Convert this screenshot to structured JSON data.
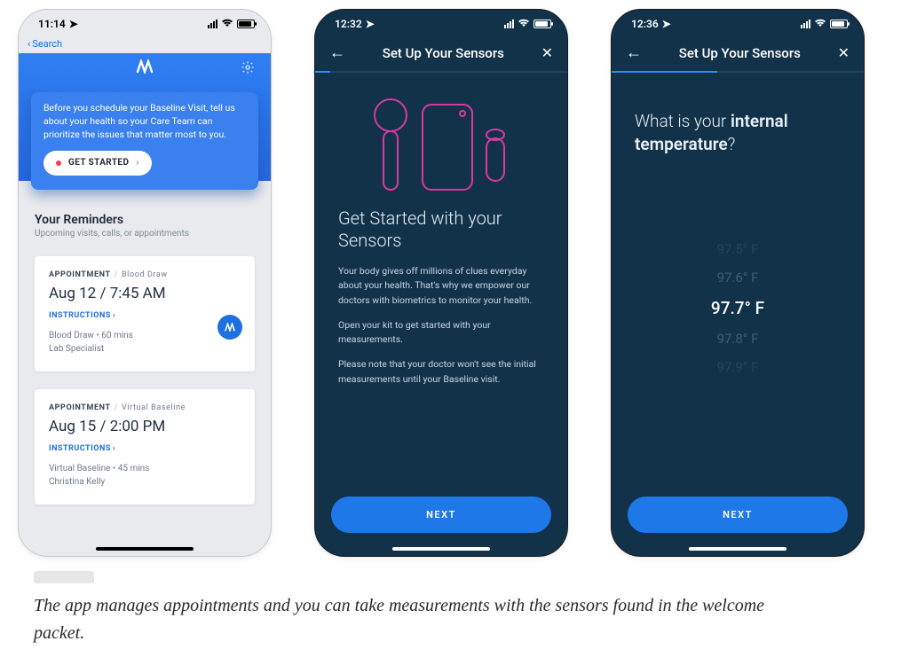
{
  "screen1": {
    "status_time": "11:14",
    "back_label": "Search",
    "hero_copy": "Before you schedule your Baseline Visit, tell us about your health so your Care Team can prioritize the issues that matter most to you.",
    "get_started_label": "GET STARTED",
    "reminders_title": "Your Reminders",
    "reminders_sub": "Upcoming visits, calls, or appointments",
    "appointments": [
      {
        "tag_a": "APPOINTMENT",
        "tag_b": "Blood Draw",
        "time": "Aug 12 / 7:45 AM",
        "instructions": "INSTRUCTIONS",
        "meta1": "Blood Draw • 60 mins",
        "meta2": "Lab Specialist",
        "has_badge": true
      },
      {
        "tag_a": "APPOINTMENT",
        "tag_b": "Virtual Baseline",
        "time": "Aug 15 / 2:00 PM",
        "instructions": "INSTRUCTIONS",
        "meta1": "Virtual Baseline • 45 mins",
        "meta2": "Christina Kelly",
        "has_badge": false
      }
    ]
  },
  "screen2": {
    "status_time": "12:32",
    "nav_title": "Set Up Your Sensors",
    "progress_pct": 6,
    "title": "Get Started with your Sensors",
    "p1": "Your body gives off millions of clues everyday about your health. That's why we empower our doctors with biometrics to monitor your health.",
    "p2": "Open your kit to get started with your measurements.",
    "p3": "Please note that your doctor won't see the initial measurements until your Baseline visit.",
    "next_label": "NEXT"
  },
  "screen3": {
    "status_time": "12:36",
    "nav_title": "Set Up Your Sensors",
    "progress_pct": 42,
    "question_pre": "What is your ",
    "question_bold": "internal temperature",
    "question_post": "?",
    "options": [
      "97.5°  F",
      "97.6°  F",
      "97.7°  F",
      "97.8°  F",
      "97.9°  F"
    ],
    "selected_index": 2,
    "next_label": "NEXT"
  },
  "caption": "The app manages appointments and you can take measurements with the sensors found in the welcome packet.",
  "colors": {
    "brand_blue": "#1e6fe0",
    "dark_bg": "#12324a",
    "accent_pink": "#d73aa0"
  }
}
